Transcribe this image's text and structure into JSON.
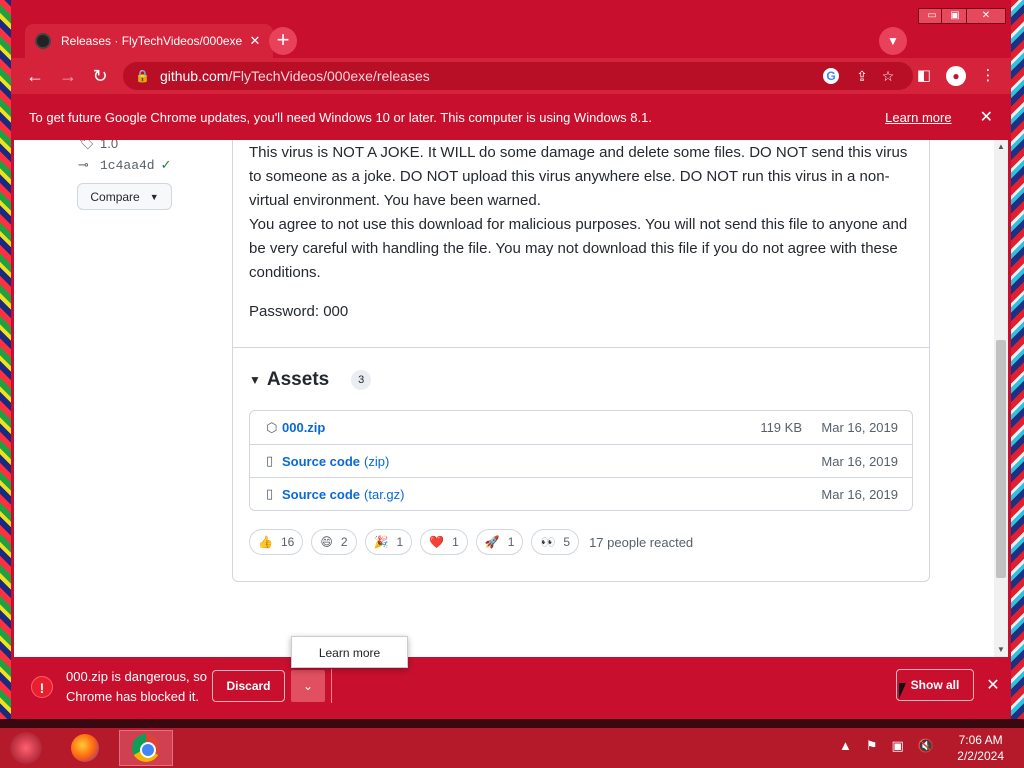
{
  "browser": {
    "tab_title": "Releases · FlyTechVideos/000exe",
    "tab_close": "✕",
    "new_tab": "+",
    "url_host": "github.com",
    "url_path": "/FlyTechVideos/000exe/releases",
    "window_controls": [
      "▭",
      "▣",
      "✕"
    ]
  },
  "infobar": {
    "message": "To get future Google Chrome updates, you'll need Windows 10 or later. This computer is using Windows 8.1.",
    "learn_more": "Learn more",
    "close": "✕"
  },
  "release": {
    "tag": "1.0",
    "commit": "1c4aa4d",
    "compare_label": "Compare",
    "body_paragraph": "This virus is NOT A JOKE. It WILL do some damage and delete some files. DO NOT send this virus to someone as a joke. DO NOT upload this virus anywhere else. DO NOT run this virus in a non-virtual environment. You have been warned.",
    "body_paragraph2": "You agree to not use this download for malicious purposes. You will not send this file to anyone and be very careful with handling the file. You may not download this file if you do not agree with these conditions.",
    "password": "Password: 000",
    "assets_title": "Assets",
    "assets_count": "3",
    "assets": [
      {
        "name": "000.zip",
        "sub": "",
        "size": "119 KB",
        "date": "Mar 16, 2019"
      },
      {
        "name": "Source code",
        "sub": "(zip)",
        "size": "",
        "date": "Mar 16, 2019"
      },
      {
        "name": "Source code",
        "sub": "(tar.gz)",
        "size": "",
        "date": "Mar 16, 2019"
      }
    ],
    "reactions": [
      {
        "emoji": "👍",
        "count": "16"
      },
      {
        "emoji": "😄",
        "count": "2"
      },
      {
        "emoji": "🎉",
        "count": "1"
      },
      {
        "emoji": "❤️",
        "count": "1"
      },
      {
        "emoji": "🚀",
        "count": "1"
      },
      {
        "emoji": "👀",
        "count": "5"
      }
    ],
    "reacted_text": "17 people reacted"
  },
  "download_bar": {
    "warning_line1": "000.zip is dangerous, so",
    "warning_line2": "Chrome has blocked it.",
    "discard": "Discard",
    "menu_caret": "⌄",
    "show_all": "Show all",
    "close": "✕",
    "popup_learn_more": "Learn more"
  },
  "taskbar": {
    "time": "7:06 AM",
    "date": "2/2/2024"
  }
}
